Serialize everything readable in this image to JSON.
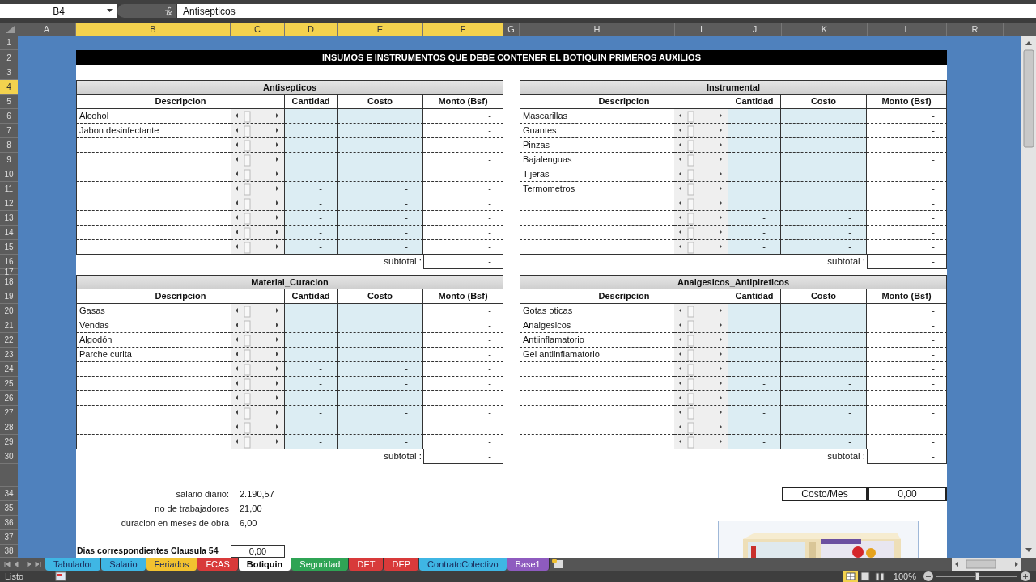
{
  "formula_bar": {
    "name_box": "B4",
    "formula": "Antisepticos"
  },
  "columns": [
    {
      "label": "A",
      "selected": false
    },
    {
      "label": "B",
      "selected": true
    },
    {
      "label": "C",
      "selected": true
    },
    {
      "label": "D",
      "selected": true
    },
    {
      "label": "E",
      "selected": true
    },
    {
      "label": "F",
      "selected": true
    },
    {
      "label": "G",
      "selected": false
    },
    {
      "label": "H",
      "selected": false
    },
    {
      "label": "I",
      "selected": false
    },
    {
      "label": "J",
      "selected": false
    },
    {
      "label": "K",
      "selected": false
    },
    {
      "label": "L",
      "selected": false
    },
    {
      "label": "R",
      "selected": false
    }
  ],
  "rows": [
    {
      "label": "1",
      "selected": false
    },
    {
      "label": "2",
      "selected": false
    },
    {
      "label": "3",
      "selected": false
    },
    {
      "label": "4",
      "selected": true
    },
    {
      "label": "5",
      "selected": false
    },
    {
      "label": "6",
      "selected": false
    },
    {
      "label": "7",
      "selected": false
    },
    {
      "label": "8",
      "selected": false
    },
    {
      "label": "9",
      "selected": false
    },
    {
      "label": "10",
      "selected": false
    },
    {
      "label": "11",
      "selected": false
    },
    {
      "label": "12",
      "selected": false
    },
    {
      "label": "13",
      "selected": false
    },
    {
      "label": "14",
      "selected": false
    },
    {
      "label": "15",
      "selected": false
    },
    {
      "label": "16",
      "selected": false
    },
    {
      "label": "17",
      "selected": false
    },
    {
      "label": "18",
      "selected": false
    },
    {
      "label": "19",
      "selected": false
    },
    {
      "label": "20",
      "selected": false
    },
    {
      "label": "21",
      "selected": false
    },
    {
      "label": "22",
      "selected": false
    },
    {
      "label": "23",
      "selected": false
    },
    {
      "label": "24",
      "selected": false
    },
    {
      "label": "25",
      "selected": false
    },
    {
      "label": "26",
      "selected": false
    },
    {
      "label": "27",
      "selected": false
    },
    {
      "label": "28",
      "selected": false
    },
    {
      "label": "29",
      "selected": false
    },
    {
      "label": "30",
      "selected": false
    },
    {
      "label": "34",
      "selected": false
    },
    {
      "label": "35",
      "selected": false
    },
    {
      "label": "36",
      "selected": false
    },
    {
      "label": "37",
      "selected": false
    },
    {
      "label": "38",
      "selected": false
    }
  ],
  "sheet": {
    "title": "INSUMOS E INSTRUMENTOS QUE DEBE CONTENER EL BOTIQUIN PRIMEROS AUXILIOS",
    "sections": [
      {
        "title": "Antisepticos",
        "headers": [
          "Descripcion",
          "Cantidad",
          "Costo",
          "Monto (Bsf)"
        ],
        "rows": [
          {
            "descripcion": "Alcohol",
            "monto": "-"
          },
          {
            "descripcion": "Jabon desinfectante",
            "monto": "-"
          },
          {
            "monto": "-"
          },
          {
            "monto": "-"
          },
          {
            "monto": "-"
          },
          {
            "cantidad": "-",
            "costo": "-",
            "monto": "-"
          },
          {
            "cantidad": "-",
            "costo": "-",
            "monto": "-"
          },
          {
            "cantidad": "-",
            "costo": "-",
            "monto": "-"
          },
          {
            "cantidad": "-",
            "costo": "-",
            "monto": "-"
          },
          {
            "cantidad": "-",
            "costo": "-",
            "monto": "-"
          }
        ],
        "subtotal_label": "subtotal :",
        "subtotal": "-"
      },
      {
        "title": "Instrumental",
        "headers": [
          "Descripcion",
          "Cantidad",
          "Costo",
          "Monto (Bsf)"
        ],
        "rows": [
          {
            "descripcion": "Mascarillas",
            "monto": "-"
          },
          {
            "descripcion": "Guantes",
            "monto": "-"
          },
          {
            "descripcion": "Pinzas",
            "monto": "-"
          },
          {
            "descripcion": "Bajalenguas",
            "monto": "-"
          },
          {
            "descripcion": "Tijeras",
            "monto": "-"
          },
          {
            "descripcion": "Termometros",
            "monto": "-"
          },
          {
            "monto": "-"
          },
          {
            "cantidad": "-",
            "costo": "-",
            "monto": "-"
          },
          {
            "cantidad": "-",
            "costo": "-",
            "monto": "-"
          },
          {
            "cantidad": "-",
            "costo": "-",
            "monto": "-"
          }
        ],
        "subtotal_label": "subtotal :",
        "subtotal": "-"
      },
      {
        "title": "Material_Curacion",
        "headers": [
          "Descripcion",
          "Cantidad",
          "Costo",
          "Monto (Bsf)"
        ],
        "rows": [
          {
            "descripcion": "Gasas",
            "monto": "-"
          },
          {
            "descripcion": "Vendas",
            "monto": "-"
          },
          {
            "descripcion": "Algodón",
            "monto": "-"
          },
          {
            "descripcion": "Parche curita",
            "monto": "-"
          },
          {
            "cantidad": "-",
            "costo": "-",
            "monto": "-"
          },
          {
            "cantidad": "-",
            "costo": "-",
            "monto": "-"
          },
          {
            "cantidad": "-",
            "costo": "-",
            "monto": "-"
          },
          {
            "cantidad": "-",
            "costo": "-",
            "monto": "-"
          },
          {
            "cantidad": "-",
            "costo": "-",
            "monto": "-"
          },
          {
            "cantidad": "-",
            "costo": "-",
            "monto": "-"
          }
        ],
        "subtotal_label": "subtotal :",
        "subtotal": "-"
      },
      {
        "title": "Analgesicos_Antipireticos",
        "headers": [
          "Descripcion",
          "Cantidad",
          "Costo",
          "Monto (Bsf)"
        ],
        "rows": [
          {
            "descripcion": "Gotas oticas",
            "monto": "-"
          },
          {
            "descripcion": "Analgesicos",
            "monto": "-"
          },
          {
            "descripcion": "Antiinflamatorio",
            "monto": "-"
          },
          {
            "descripcion": "Gel antiinflamatorio",
            "monto": "-"
          },
          {
            "monto": "-"
          },
          {
            "cantidad": "-",
            "costo": "-",
            "monto": "-"
          },
          {
            "cantidad": "-",
            "costo": "-",
            "monto": "-"
          },
          {
            "cantidad": "-",
            "costo": "-",
            "monto": "-"
          },
          {
            "cantidad": "-",
            "costo": "-",
            "monto": "-"
          },
          {
            "cantidad": "-",
            "costo": "-",
            "monto": "-"
          }
        ],
        "subtotal_label": "subtotal :",
        "subtotal": "-"
      }
    ],
    "summary": [
      {
        "label": "salario diario:",
        "value": "2.190,57"
      },
      {
        "label": "no de trabajadores",
        "value": "21,00"
      },
      {
        "label": "duracion en meses de obra",
        "value": "6,00"
      }
    ],
    "clausula": {
      "label": "Dias correspondientes Clausula 54",
      "value": "0,00"
    },
    "costo_mes": {
      "label": "Costo/Mes",
      "value": "0,00"
    }
  },
  "sheet_tabs": [
    {
      "label": "Tabulador",
      "color": "#3fb6e4",
      "selected": false
    },
    {
      "label": "Salario",
      "color": "#3fb6e4",
      "selected": false
    },
    {
      "label": "Feriados",
      "color": "#f2c230",
      "selected": false
    },
    {
      "label": "FCAS",
      "color": "#d83a3a",
      "selected": false
    },
    {
      "label": "Botiquin",
      "color": "#ffffff",
      "selected": true
    },
    {
      "label": "Seguridad",
      "color": "#2fa455",
      "selected": false
    },
    {
      "label": "DET",
      "color": "#d83a3a",
      "selected": false
    },
    {
      "label": "DEP",
      "color": "#d83a3a",
      "selected": false
    },
    {
      "label": "ContratoColectivo",
      "color": "#3fb6e4",
      "selected": false
    },
    {
      "label": "Base1",
      "color": "#8e5bbf",
      "selected": false
    }
  ],
  "status_bar": {
    "text": "Listo",
    "zoom": "100%",
    "zoom_slider": {
      "level": 0.5
    }
  }
}
